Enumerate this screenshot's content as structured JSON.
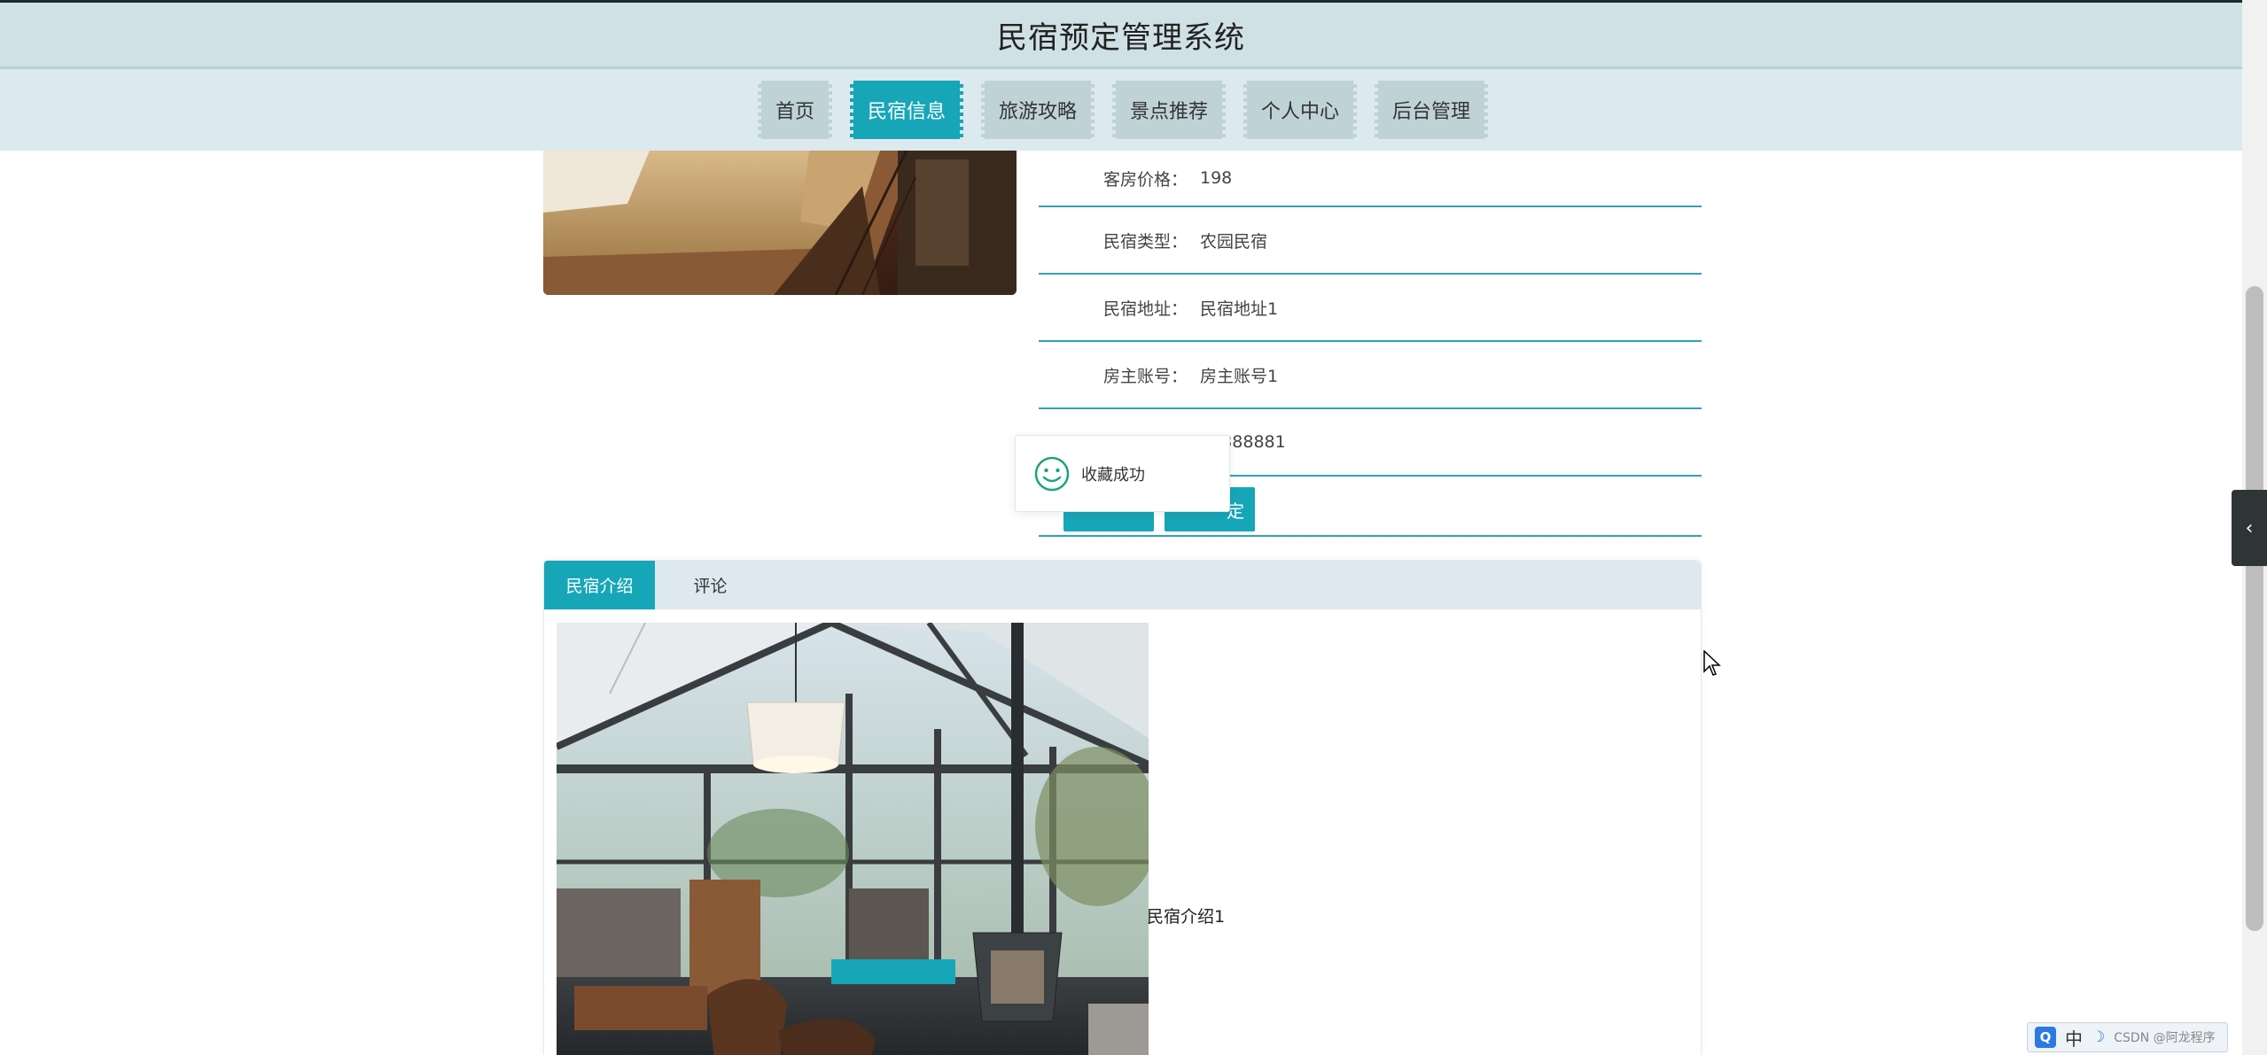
{
  "header": {
    "title": "民宿预定管理系统"
  },
  "nav": {
    "items": [
      {
        "label": "首页",
        "active": false
      },
      {
        "label": "民宿信息",
        "active": true
      },
      {
        "label": "旅游攻略",
        "active": false
      },
      {
        "label": "景点推荐",
        "active": false
      },
      {
        "label": "个人中心",
        "active": false
      },
      {
        "label": "后台管理",
        "active": false
      }
    ]
  },
  "detail": {
    "rows": [
      {
        "label": "客房价格：",
        "value": "198"
      },
      {
        "label": "民宿类型：",
        "value": "农园民宿"
      },
      {
        "label": "民宿地址：",
        "value": "民宿地址1"
      },
      {
        "label": "房主账号：",
        "value": "房主账号1"
      },
      {
        "label": "",
        "value": "23888881"
      }
    ],
    "favorite_label": "",
    "book_label": "定"
  },
  "toast": {
    "message": "收藏成功"
  },
  "tabs": {
    "items": [
      {
        "label": "民宿介绍",
        "active": true
      },
      {
        "label": "评论",
        "active": false
      }
    ],
    "intro_text": "民宿介绍1"
  },
  "sidebar_toggle": {
    "glyph": "‹"
  },
  "ime": {
    "logo": "Q",
    "mode": "中",
    "watermark": "CSDN @阿龙程序"
  },
  "colors": {
    "accent": "#17a6b8",
    "header_bg": "#cfe1e4",
    "nav_bg": "#dce9ee",
    "row_line": "#2fa3b5"
  }
}
